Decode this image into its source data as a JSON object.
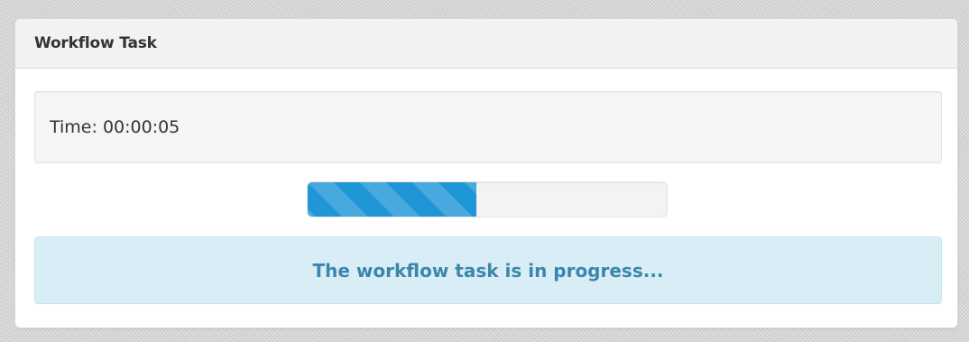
{
  "panel": {
    "title": "Workflow Task"
  },
  "timer": {
    "text": "Time: 00:00:05"
  },
  "progress": {
    "fraction": 0.47,
    "color": "#1f96d6"
  },
  "status": {
    "message": "The workflow task is in progress..."
  }
}
